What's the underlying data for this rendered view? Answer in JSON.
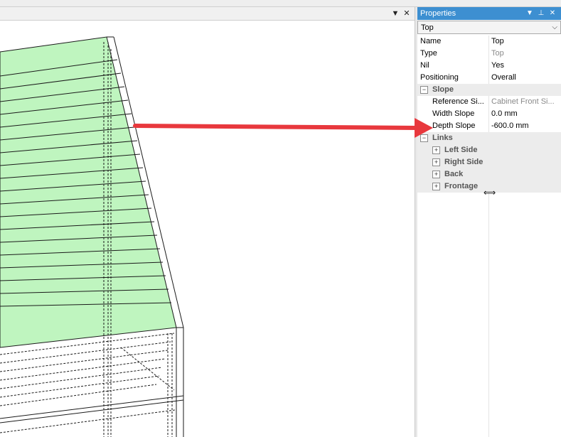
{
  "viewport": {
    "dropdown_glyph": "▼",
    "close_glyph": "✕"
  },
  "properties": {
    "title": "Properties",
    "title_buttons": {
      "dropdown": "▼",
      "pin": "⊥",
      "close": "✕"
    },
    "selected_object": "Top",
    "rows": {
      "name": {
        "label": "Name",
        "value": "Top"
      },
      "type": {
        "label": "Type",
        "value": "Top"
      },
      "nil": {
        "label": "Nil",
        "value": "Yes"
      },
      "positioning": {
        "label": "Positioning",
        "value": "Overall"
      },
      "slope": {
        "label": "Slope",
        "toggle": "−"
      },
      "reference_side": {
        "label": "Reference Si...",
        "value": "Cabinet Front Si..."
      },
      "width_slope": {
        "label": "Width Slope",
        "value": "0.0 mm"
      },
      "depth_slope": {
        "label": "Depth Slope",
        "value": "-600.0 mm"
      },
      "links": {
        "label": "Links",
        "toggle": "−"
      },
      "left_side": {
        "label": "Left Side",
        "toggle": "+"
      },
      "right_side": {
        "label": "Right Side",
        "toggle": "+"
      },
      "back": {
        "label": "Back",
        "toggle": "+"
      },
      "frontage": {
        "label": "Frontage",
        "toggle": "+"
      }
    }
  },
  "annotation": {
    "arrow_color": "#e8383d",
    "fill_color": "#bff5bf"
  },
  "colors": {
    "title_bar": "#3d8fd1",
    "category_bg": "#ececec"
  }
}
